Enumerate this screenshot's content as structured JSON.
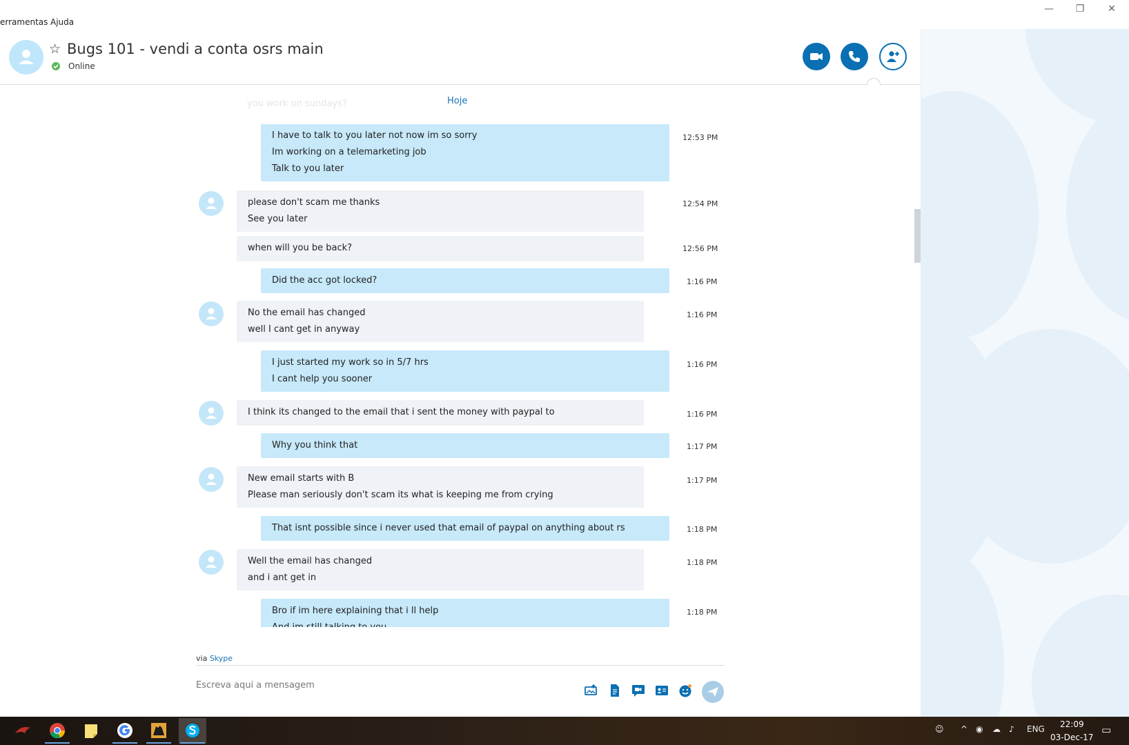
{
  "menu": {
    "tools": "erramentas",
    "help": "Ajuda"
  },
  "window_controls": {
    "minimize": "—",
    "restore": "❐",
    "close": "✕"
  },
  "header": {
    "title": "Bugs 101 - vendi a conta osrs main",
    "status": "Online"
  },
  "messages_area": {
    "faded_text": "you work on sundays?",
    "day_label": "Hoje",
    "messages": [
      {
        "dir": "out",
        "time": "12:53 PM",
        "lines": [
          "I have to talk to you later not now im so sorry",
          "Im working on a telemarketing job",
          "Talk to you later"
        ]
      },
      {
        "dir": "in",
        "time": "12:54 PM",
        "lines": [
          "please don't scam me thanks",
          "See you later"
        ]
      },
      {
        "dir": "in",
        "time": "12:56 PM",
        "lines": [
          "when will you be back?"
        ]
      },
      {
        "dir": "out",
        "time": "1:16 PM",
        "lines": [
          "Did the acc got locked?"
        ]
      },
      {
        "dir": "in",
        "time": "1:16 PM",
        "lines": [
          "No the email has changed",
          "well I cant get in anyway"
        ]
      },
      {
        "dir": "out",
        "time": "1:16 PM",
        "lines": [
          "I just started my work so in 5/7 hrs",
          "I cant help you sooner"
        ]
      },
      {
        "dir": "in",
        "time": "1:16 PM",
        "lines": [
          "I think its changed to the email that i sent the money with paypal to"
        ]
      },
      {
        "dir": "out",
        "time": "1:17 PM",
        "lines": [
          "Why you think that"
        ]
      },
      {
        "dir": "in",
        "time": "1:17 PM",
        "lines": [
          "New email starts with B",
          "Please man seriously don't scam its what is keeping me from crying"
        ]
      },
      {
        "dir": "out",
        "time": "1:18 PM",
        "lines": [
          "That isnt possible since i never used that email of paypal on anything about rs"
        ]
      },
      {
        "dir": "in",
        "time": "1:18 PM",
        "lines": [
          "Well the email has changed",
          "and i ant get in"
        ]
      },
      {
        "dir": "out",
        "time": "1:18 PM",
        "lines": [
          "Bro if im here explaining that i ll help",
          "And im still talking to you"
        ]
      }
    ]
  },
  "composer": {
    "via_prefix": "via",
    "via_link": "Skype",
    "placeholder": "Escreva aqui a mensagem"
  },
  "taskbar": {
    "apps": [
      "rog-icon",
      "chrome-icon",
      "sticky-notes-icon",
      "google-icon",
      "csgo-icon",
      "skype-icon"
    ],
    "tray_lang": "ENG",
    "time": "22:09",
    "date": "03-Dec-17"
  },
  "colors": {
    "accent": "#0a6fb3",
    "bubble_out": "#c7e9fa",
    "bubble_in": "#eff2f6",
    "link": "#1a73b8",
    "online": "#5cb85c"
  }
}
